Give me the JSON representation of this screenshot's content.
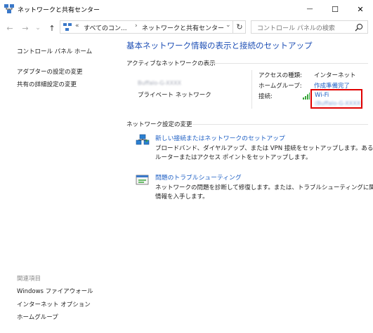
{
  "window": {
    "title": "ネットワークと共有センター",
    "minimize_glyph": "—",
    "maximize_glyph": "☐",
    "close_glyph": "✕"
  },
  "toolbar": {
    "back_glyph": "←",
    "forward_glyph": "→",
    "recent_glyph": "⌄",
    "up_glyph": "↑",
    "refresh_glyph": "↻"
  },
  "address": {
    "overflow": "«",
    "crumbs": [
      "すべてのコン...",
      "ネットワークと共有センター"
    ],
    "separator": "›",
    "dropdown_glyph": "⌄"
  },
  "search": {
    "placeholder": "コントロール パネルの検索"
  },
  "left_pane": {
    "home": "コントロール パネル ホーム",
    "links": [
      "アダプターの設定の変更",
      "共有の詳細設定の変更"
    ],
    "see_also_title": "関連項目",
    "see_also": [
      "Windows ファイアウォール",
      "インターネット オプション",
      "ホームグループ"
    ]
  },
  "main": {
    "title": "基本ネットワーク情報の表示と接続のセットアップ",
    "active_title": "アクティブなネットワークの表示",
    "network_name": "Buffalo-G-XXXX",
    "network_type": "プライベート ネットワーク",
    "access_type_label": "アクセスの種類:",
    "access_type_value": "インターネット",
    "homegroup_label": "ホームグループ:",
    "homegroup_value": "作成準備完了",
    "connections_label": "接続:",
    "connection_name": "Wi-Fi",
    "connection_ssid": "(Buffalo-G-XXXX)",
    "change_title": "ネットワーク設定の変更",
    "tasks": [
      {
        "link": "新しい接続またはネットワークのセットアップ",
        "desc1": "ブロードバンド、ダイヤルアップ、または VPN 接続をセットアップします。あるいは、",
        "desc2": "ルーターまたはアクセス ポイントをセットアップします。"
      },
      {
        "link": "問題のトラブルシューティング",
        "desc1": "ネットワークの問題を診断して修復します。または、トラブルシューティングに関する",
        "desc2": "情報を入手します。"
      }
    ]
  },
  "colors": {
    "link": "#1e5fc4",
    "title": "#1e4fb5",
    "highlight": "#e00000"
  }
}
